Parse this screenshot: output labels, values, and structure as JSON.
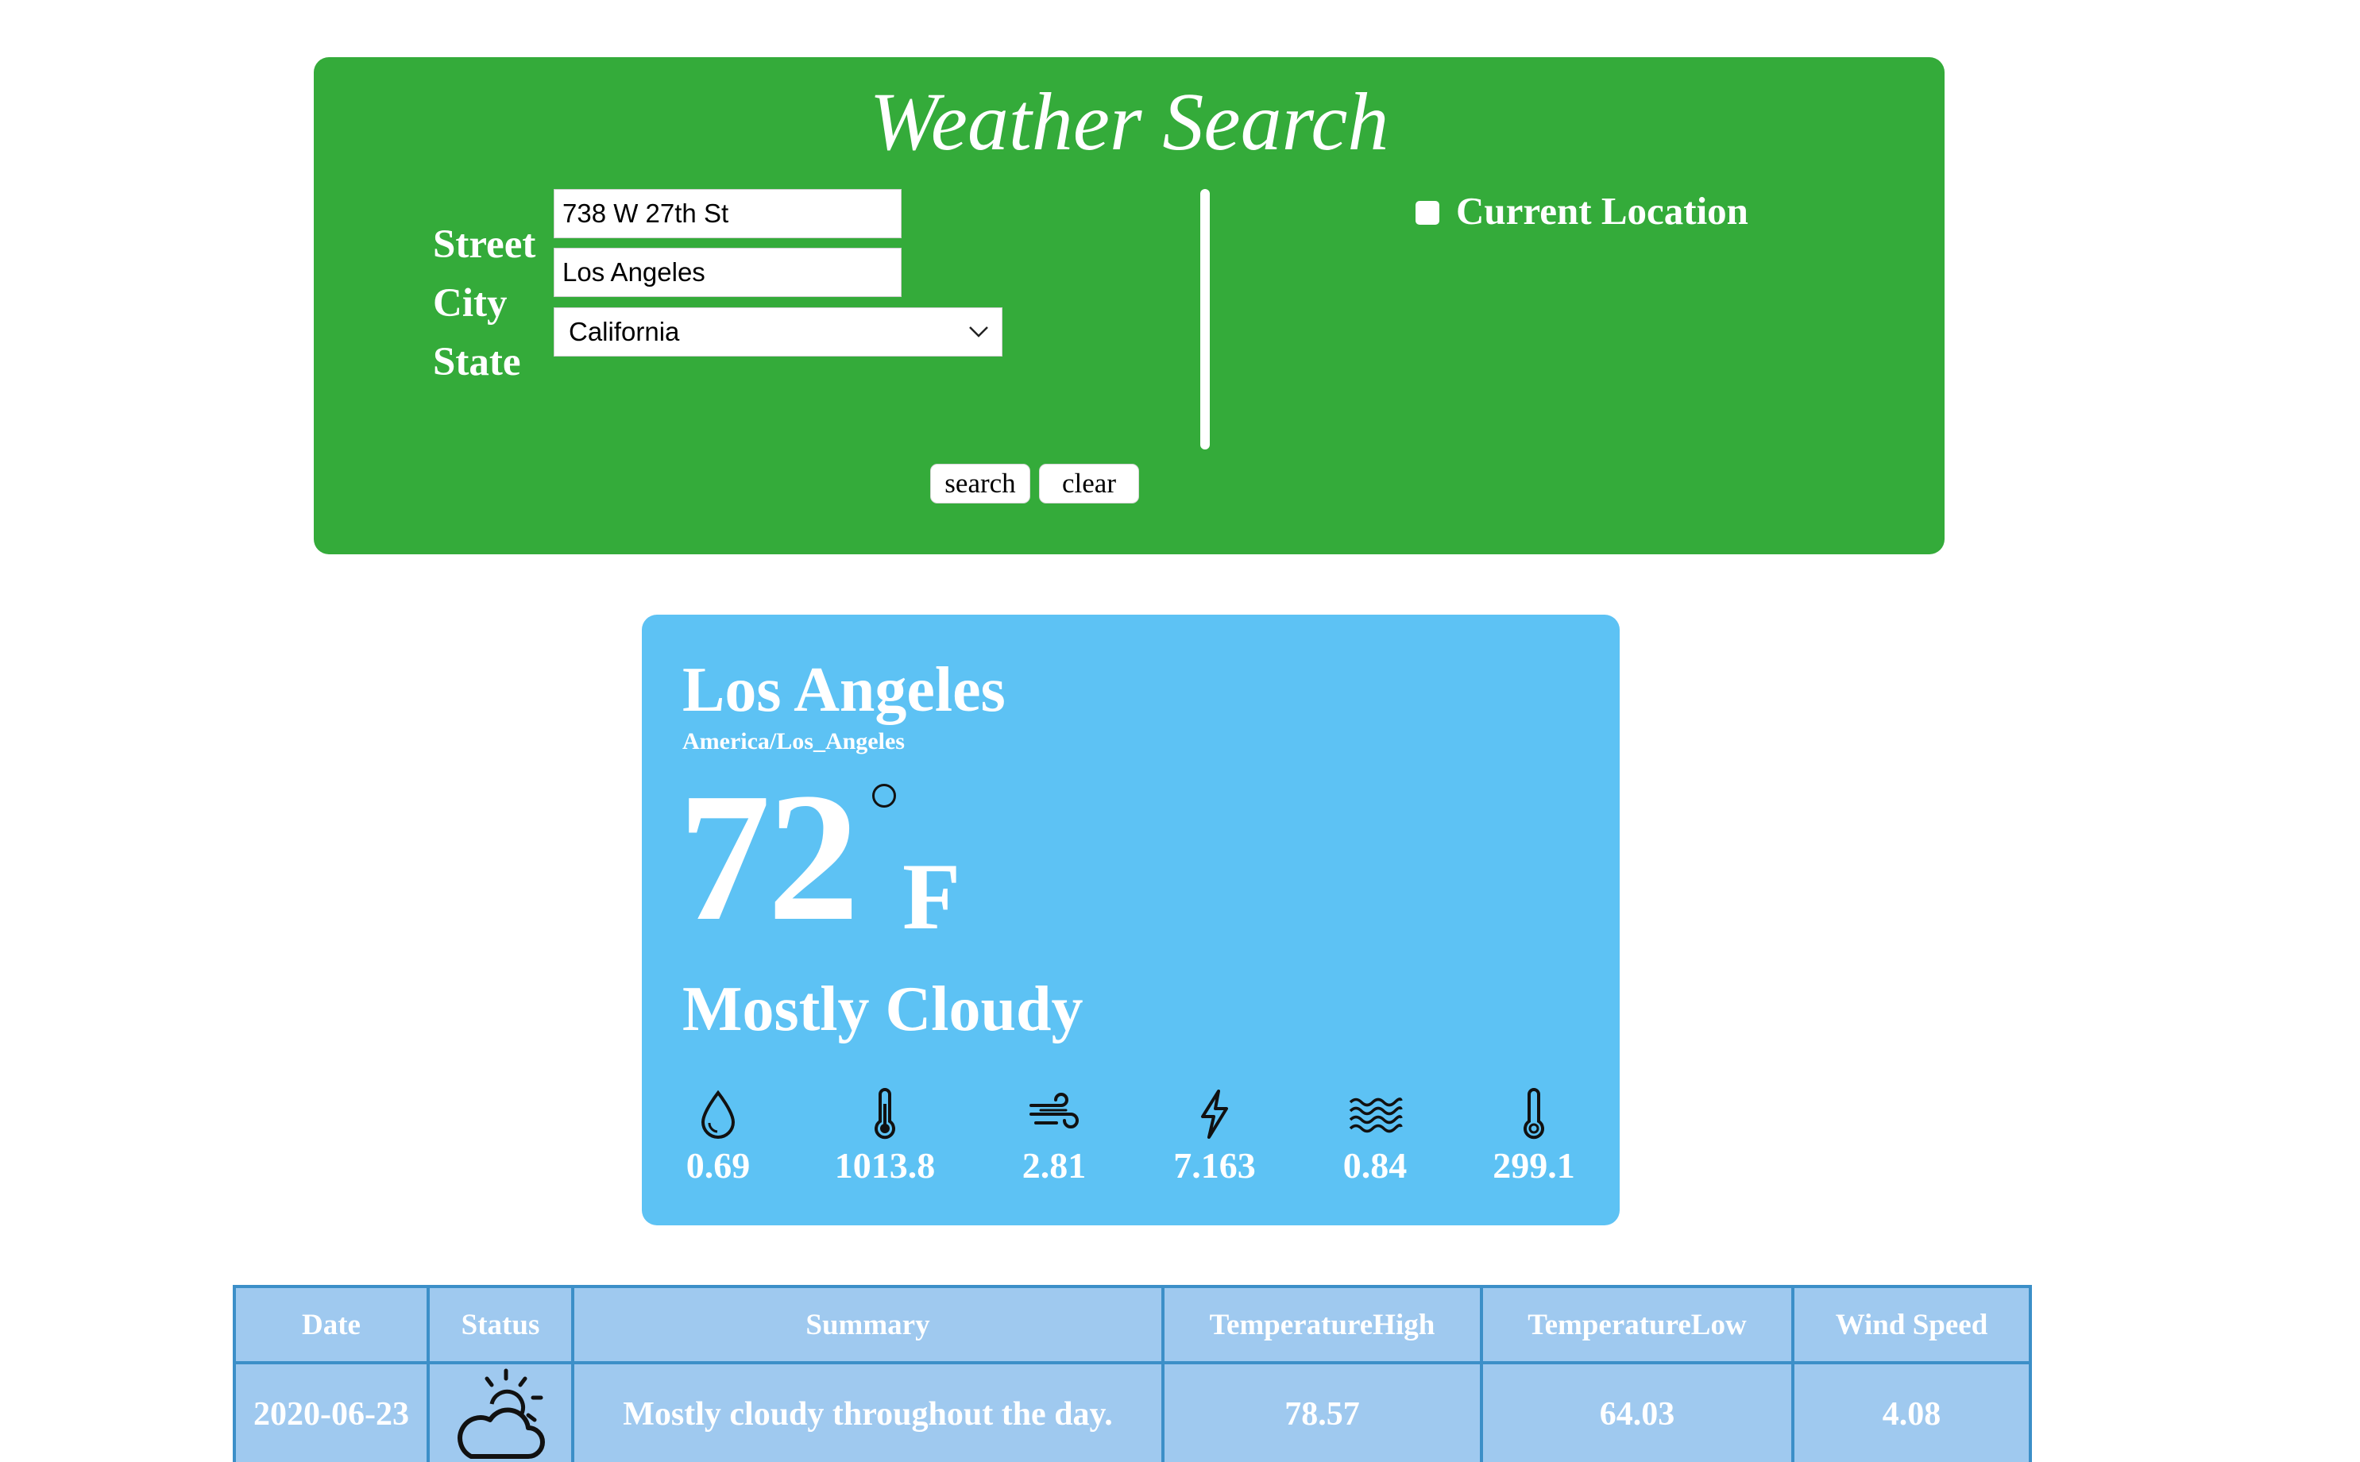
{
  "search": {
    "title": "Weather Search",
    "street_label": "Street",
    "street_value": "738 W 27th St",
    "city_label": "City",
    "city_value": "Los Angeles",
    "state_label": "State",
    "state_selected": "California",
    "current_location_label": "Current Location",
    "current_location_checked": false,
    "search_button": "search",
    "clear_button": "clear",
    "panel_color": "#34ab3a"
  },
  "weather": {
    "city": "Los Angeles",
    "timezone": "America/Los_Angeles",
    "temperature": "72",
    "unit": "F",
    "condition": "Mostly Cloudy",
    "card_color": "#5dc2f4",
    "metrics": [
      {
        "icon": "humidity-drop-icon",
        "value": "0.69"
      },
      {
        "icon": "pressure-thermometer-icon",
        "value": "1013.8"
      },
      {
        "icon": "wind-icon",
        "value": "2.81"
      },
      {
        "icon": "visibility-bolt-icon",
        "value": "7.163"
      },
      {
        "icon": "cloud-cover-waves-icon",
        "value": "0.84"
      },
      {
        "icon": "ozone-thermometer-icon",
        "value": "299.1"
      }
    ]
  },
  "forecast": {
    "headers": [
      "Date",
      "Status",
      "Summary",
      "TemperatureHigh",
      "TemperatureLow",
      "Wind Speed"
    ],
    "rows": [
      {
        "date": "2020-06-23",
        "status_icon": "partly-cloudy-day-icon",
        "summary": "Mostly cloudy throughout the day.",
        "temp_high": "78.57",
        "temp_low": "64.03",
        "wind_speed": "4.08"
      }
    ],
    "cell_color": "#9fc9ef",
    "border_color": "#3c8fc8"
  }
}
